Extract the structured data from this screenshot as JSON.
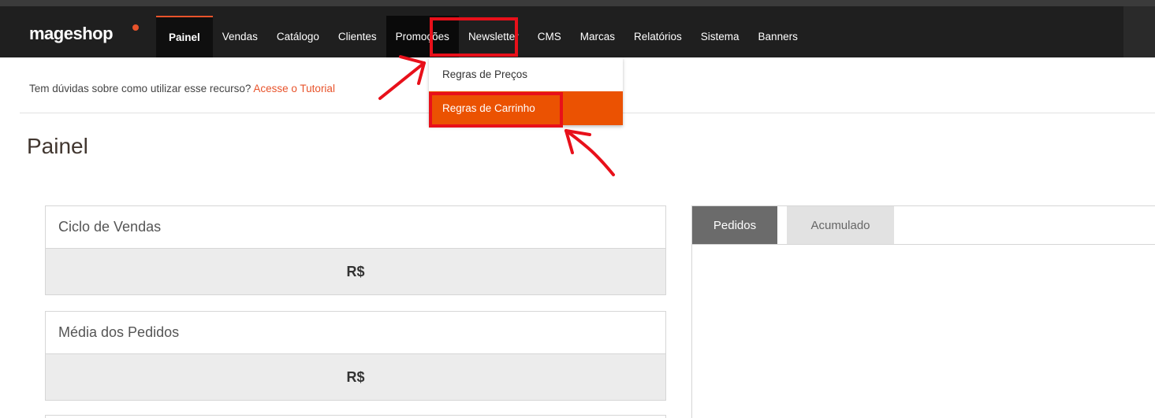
{
  "app": {
    "logo": "mageshop"
  },
  "nav": {
    "items": [
      {
        "label": "Painel"
      },
      {
        "label": "Vendas"
      },
      {
        "label": "Catálogo"
      },
      {
        "label": "Clientes"
      },
      {
        "label": "Promoções"
      },
      {
        "label": "Newsletter"
      },
      {
        "label": "CMS"
      },
      {
        "label": "Marcas"
      },
      {
        "label": "Relatórios"
      },
      {
        "label": "Sistema"
      },
      {
        "label": "Banners"
      }
    ]
  },
  "dropdown": {
    "items": [
      {
        "label": "Regras de Preços"
      },
      {
        "label": "Regras de Carrinho"
      }
    ]
  },
  "help": {
    "text": "Tem dúvidas sobre como utilizar esse recurso? ",
    "link": "Acesse o Tutorial"
  },
  "page": {
    "title": "Painel"
  },
  "cards": [
    {
      "title": "Ciclo de Vendas",
      "value": "R$"
    },
    {
      "title": "Média dos Pedidos",
      "value": "R$"
    }
  ],
  "tabs": [
    {
      "label": "Pedidos"
    },
    {
      "label": "Acumulado"
    }
  ],
  "colors": {
    "accent": "#eb5202",
    "highlight": "#e8101a",
    "topbar": "#1f1f1f"
  },
  "icons": {
    "logo_mark": "orange-dot-icon",
    "annotations": "red-arrow-icon"
  }
}
